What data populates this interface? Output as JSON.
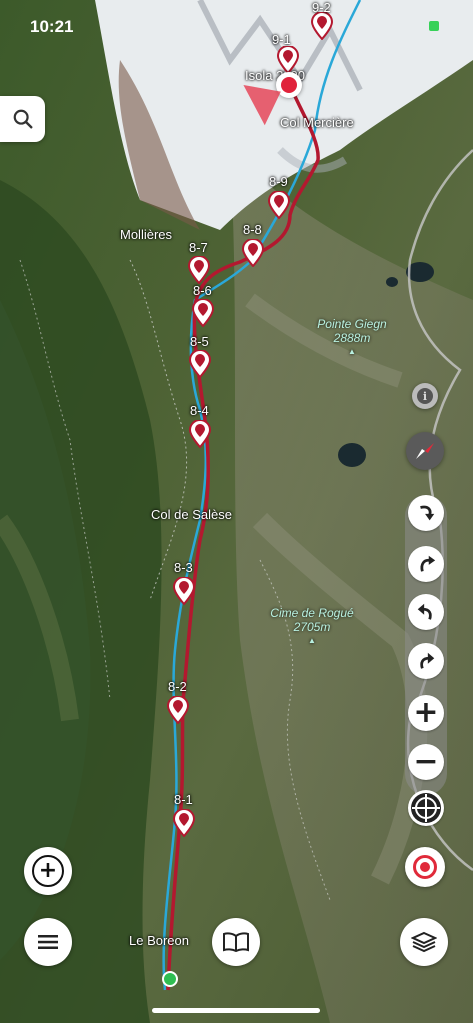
{
  "status_bar": {
    "time": "10:21"
  },
  "map": {
    "track_color": "#b3182f",
    "river_color": "#2aa8d8",
    "places": [
      {
        "id": "isola",
        "name": "Isola 2000"
      },
      {
        "id": "col-merciere",
        "name": "Col Mercière"
      },
      {
        "id": "mollieres",
        "name": "Mollières"
      },
      {
        "id": "col-de-salese",
        "name": "Col de Salèse"
      },
      {
        "id": "le-boreon",
        "name": "Le Boreon"
      }
    ],
    "peaks": [
      {
        "name": "Pointe Giegn",
        "elevation": "2888m"
      },
      {
        "name": "Cime de Rogué",
        "elevation": "2705m"
      }
    ],
    "waypoints": [
      "9-2",
      "9-1",
      "8-9",
      "8-8",
      "8-7",
      "8-6",
      "8-5",
      "8-4",
      "8-3",
      "8-2",
      "8-1"
    ]
  },
  "controls": {
    "search": "search-icon",
    "info": "info-icon",
    "compass": "compass-icon",
    "rotate": [
      "rotate-cw-icon",
      "rotate-ccw-icon",
      "turn-left-icon",
      "turn-right-icon"
    ],
    "zoom_in": "+",
    "zoom_out": "−",
    "recenter": "crosshair-icon",
    "record": "record-icon",
    "add": "+",
    "menu": "menu-icon",
    "guide": "book-icon",
    "layers": "layers-icon"
  }
}
